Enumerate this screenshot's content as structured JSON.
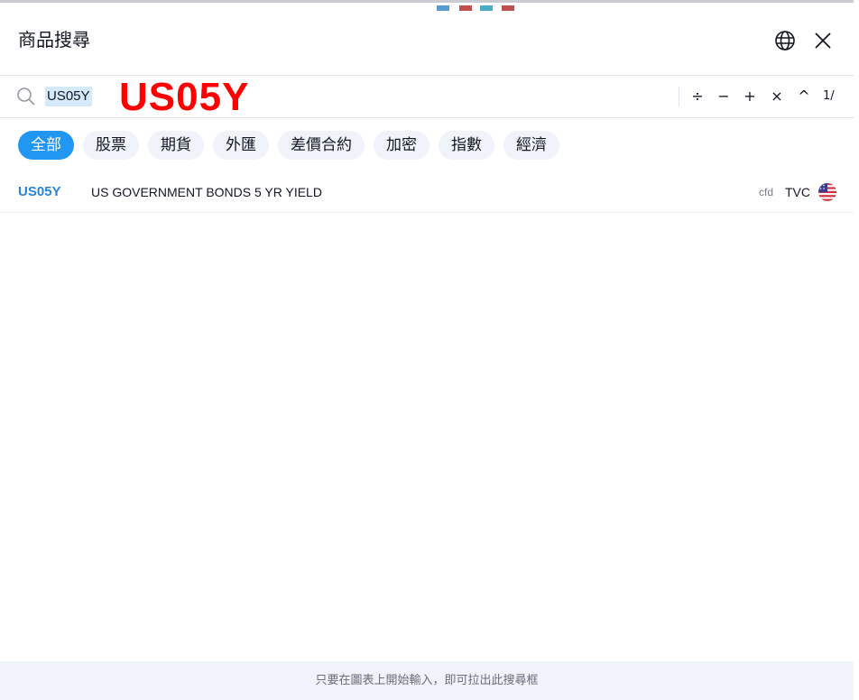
{
  "dialog": {
    "title": "商品搜尋"
  },
  "search": {
    "value": "US05Y",
    "overlay_label": "US05Y"
  },
  "toolbar": {
    "divide": "÷",
    "minus": "−",
    "plus": "+",
    "multiply": "×",
    "caret": "^",
    "counter": "1/"
  },
  "filters": [
    {
      "label": "全部",
      "active": true
    },
    {
      "label": "股票",
      "active": false
    },
    {
      "label": "期貨",
      "active": false
    },
    {
      "label": "外匯",
      "active": false
    },
    {
      "label": "差價合約",
      "active": false
    },
    {
      "label": "加密",
      "active": false
    },
    {
      "label": "指數",
      "active": false
    },
    {
      "label": "經濟",
      "active": false
    }
  ],
  "results": [
    {
      "symbol": "US05Y",
      "description": "US GOVERNMENT BONDS 5 YR YIELD",
      "type": "cfd",
      "exchange": "TVC",
      "flag_icon": "us-flag-icon"
    }
  ],
  "footer": {
    "hint": "只要在圖表上開始輸入，即可拉出此搜尋框"
  },
  "colors": {
    "accent": "#2196f3",
    "overlay_red": "#ff0000",
    "chip_bg": "#f0f3fa"
  }
}
